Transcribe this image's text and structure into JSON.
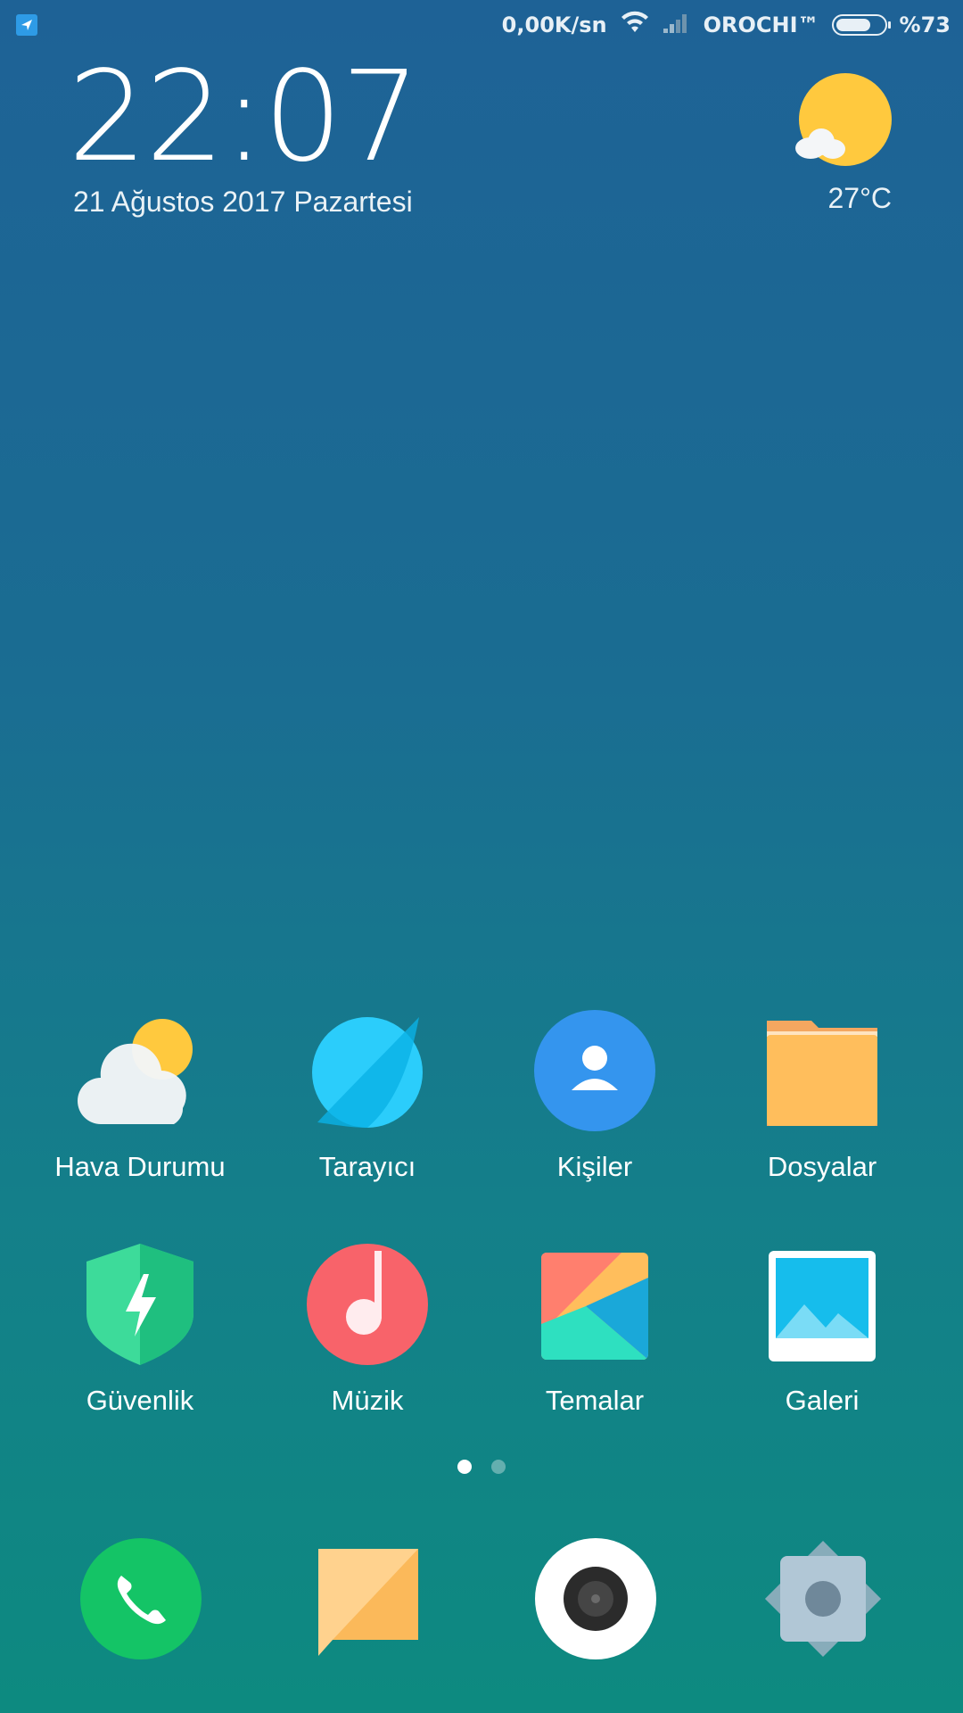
{
  "status_bar": {
    "speed": "0,00K/sn",
    "carrier": "OROCHI™",
    "battery": "%73",
    "battery_level": 0.73
  },
  "lockscreen": {
    "time": "22:07",
    "date": "21 Ağustos 2017 Pazartesi",
    "temperature": "27°C",
    "weather_icon": "sun-cloud-icon"
  },
  "apps": [
    {
      "label": "Hava Durumu",
      "icon": "weather-icon"
    },
    {
      "label": "Tarayıcı",
      "icon": "browser-icon"
    },
    {
      "label": "Kişiler",
      "icon": "contacts-icon"
    },
    {
      "label": "Dosyalar",
      "icon": "folder-icon"
    },
    {
      "label": "Güvenlik",
      "icon": "security-shield-icon"
    },
    {
      "label": "Müzik",
      "icon": "music-icon"
    },
    {
      "label": "Temalar",
      "icon": "themes-icon"
    },
    {
      "label": "Galeri",
      "icon": "gallery-icon"
    }
  ],
  "page_indicator": {
    "pages": 2,
    "active": 1
  },
  "dock": [
    {
      "icon": "phone-icon"
    },
    {
      "icon": "messages-icon"
    },
    {
      "icon": "camera-icon"
    },
    {
      "icon": "settings-icon"
    }
  ],
  "colors": {
    "sun": "#ffc93e",
    "browser": "#1fb6ea",
    "contacts": "#3495ee",
    "folder": "#ffbe5c",
    "security": "#26c388",
    "music": "#f8636a",
    "phone": "#14c466",
    "camera_ring": "#ffffff"
  }
}
